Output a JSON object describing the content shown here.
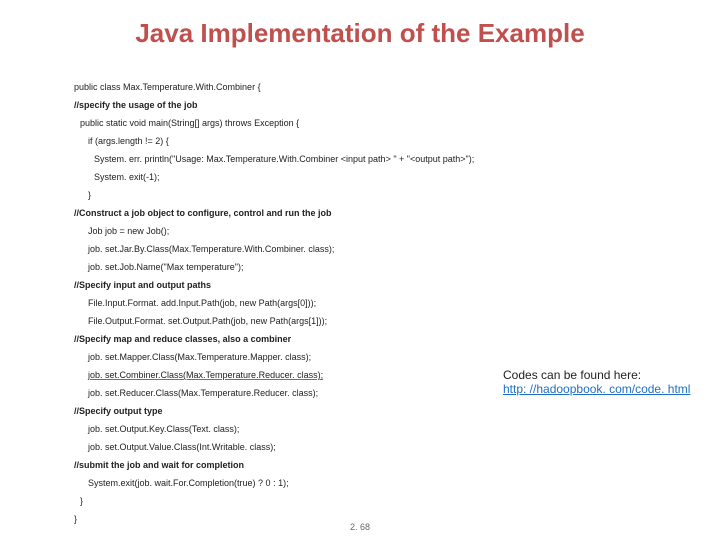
{
  "title": "Java Implementation of the Example",
  "code": {
    "l0": "public class Max.Temperature.With.Combiner {",
    "l1": "//specify the usage of the job",
    "l2": "public static void main(String[] args) throws Exception {",
    "l3": "if (args.length != 2) {",
    "l4": "System. err. println(\"Usage: Max.Temperature.With.Combiner <input path> \" + \"<output path>\");",
    "l5": "System. exit(-1);",
    "l6": "}",
    "l7": "//Construct a job object to configure, control and run the job",
    "l8": "Job job = new Job();",
    "l9": "job. set.Jar.By.Class(Max.Temperature.With.Combiner. class);",
    "l10": "job. set.Job.Name(\"Max temperature\");",
    "l11": "//Specify input and output paths",
    "l12": "File.Input.Format. add.Input.Path(job, new Path(args[0]));",
    "l13": "File.Output.Format. set.Output.Path(job, new Path(args[1]));",
    "l14": "//Specify map and reduce classes, also a combiner",
    "l15": "job. set.Mapper.Class(Max.Temperature.Mapper. class);",
    "l16": "job. set.Combiner.Class(Max.Temperature.Reducer. class);",
    "l17": "job. set.Reducer.Class(Max.Temperature.Reducer. class);",
    "l18": "//Specify output type",
    "l19": "job. set.Output.Key.Class(Text. class);",
    "l20": "job. set.Output.Value.Class(Int.Writable. class);",
    "l21": "//submit the job and wait for completion",
    "l22": "System.exit(job. wait.For.Completion(true) ? 0 : 1);",
    "l23": "}",
    "l24": "}"
  },
  "aside": {
    "text": "Codes can be found here:",
    "url_text": "http: //hadoopbook. com/code. html",
    "url_href": "http://hadoopbook.com/code.html"
  },
  "pagenum": "2. 68"
}
